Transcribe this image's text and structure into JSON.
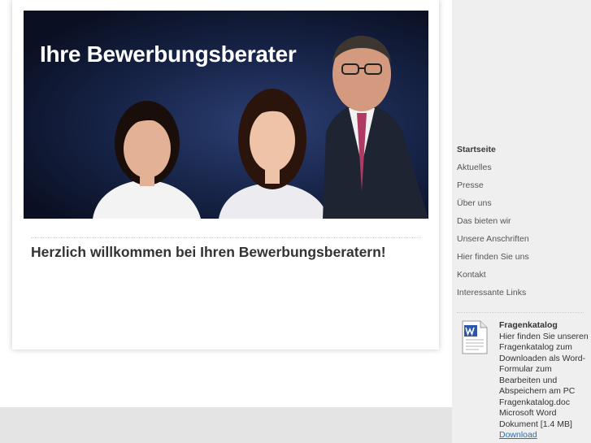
{
  "hero": {
    "title": "Ihre Bewerbungsberater"
  },
  "main": {
    "welcome_heading": "Herzlich willkommen bei Ihren Bewerbungsberatern!"
  },
  "nav": {
    "items": [
      {
        "label": "Startseite",
        "active": true
      },
      {
        "label": "Aktuelles"
      },
      {
        "label": "Presse"
      },
      {
        "label": "Über uns"
      },
      {
        "label": "Das bieten wir"
      },
      {
        "label": "Unsere Anschriften"
      },
      {
        "label": "Hier finden Sie uns"
      },
      {
        "label": "Kontakt"
      },
      {
        "label": "Interessante Links"
      }
    ]
  },
  "download": {
    "title": "Fragenkatalog",
    "description": "Hier finden Sie unseren Fragenkatalog zum Downloaden als Word-Formular zum Bearbeiten und Abspeichern am PC",
    "filename": "Fragenkatalog.doc",
    "filetype": "Microsoft Word Dokument [1.4 MB]",
    "link_label": "Download",
    "icon": "word-document-icon"
  },
  "colors": {
    "page_bg": "#e4e4e4",
    "sidebar_bg": "#efefef",
    "link": "#2a6fb0",
    "hero_bg": "#172448"
  }
}
